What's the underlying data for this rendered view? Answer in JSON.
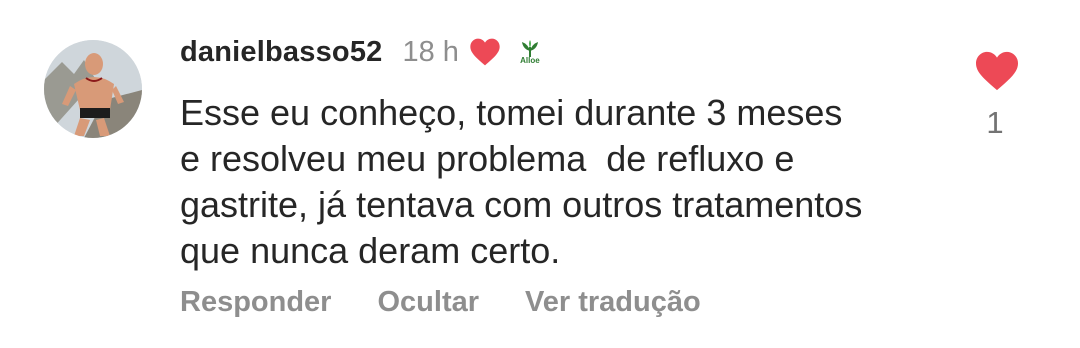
{
  "comment": {
    "username": "danielbasso52",
    "time": "18 h",
    "brand_badge": "Alloe",
    "text_lines": [
      "Esse eu conheço, tomei durante 3 meses",
      "e resolveu meu problema  de refluxo e",
      "gastrite, já tentava com outros tratamentos",
      "que nunca deram certo."
    ],
    "actions": {
      "reply": "Responder",
      "hide": "Ocultar",
      "translate": "Ver tradução"
    },
    "like_count": "1",
    "heart_color": "#ed4956"
  },
  "icons": {
    "avatar": "avatar-photo",
    "author_liked": "heart-icon",
    "brand": "aloe-logo-icon",
    "like": "heart-icon"
  }
}
